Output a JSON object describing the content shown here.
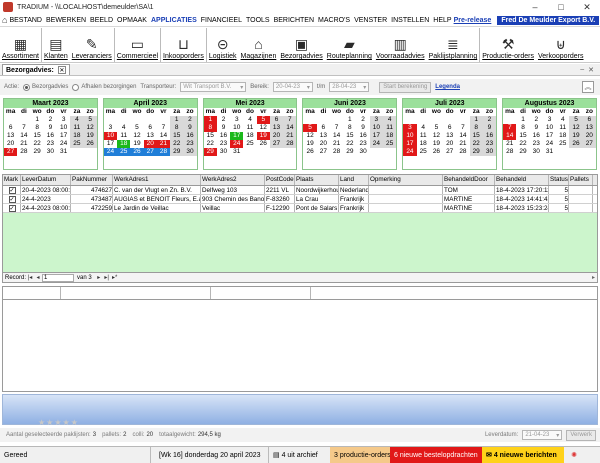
{
  "window": {
    "title": "TRADIUM - \\\\LOCALHOST\\demeulder\\SA\\1",
    "min": "–",
    "max": "□",
    "close": "✕"
  },
  "menu": {
    "items": [
      "BESTAND",
      "BEWERKEN",
      "BEELD",
      "OPMAAK",
      "APPLICATIES",
      "FINANCIEEL",
      "TOOLS",
      "BERICHTEN",
      "MACRO'S",
      "VENSTER",
      "INSTELLEN",
      "HELP"
    ],
    "active": "APPLICATIES",
    "prerelease": "Pre-release",
    "company": "Fred De Meulder Export B.V."
  },
  "toolbar": {
    "items": [
      {
        "label": "Assortiment",
        "icon": "grid-icon"
      },
      {
        "label": "Klanten",
        "icon": "clipboard-icon"
      },
      {
        "label": "Leveranciers",
        "icon": "clipboard-edit-icon"
      },
      {
        "label": "Commercieel",
        "icon": "monitor-icon"
      },
      {
        "label": "Inkooporders",
        "icon": "cart-icon"
      },
      {
        "label": "Logistiek",
        "icon": "arrow-circle-icon"
      },
      {
        "label": "Magazijnen",
        "icon": "warehouse-icon"
      },
      {
        "label": "Bezorgadvies",
        "icon": "delivery-icon"
      },
      {
        "label": "Routeplanning",
        "icon": "truck-icon"
      },
      {
        "label": "Voorraadadvies",
        "icon": "chart-icon"
      },
      {
        "label": "Paklijstplanning",
        "icon": "list-icon"
      },
      {
        "label": "Productie-orders",
        "icon": "wrench-icon"
      },
      {
        "label": "Verkooporders",
        "icon": "basket-icon"
      }
    ]
  },
  "tabs": [
    {
      "label": "Bezorgadvies:",
      "close": "✕"
    }
  ],
  "filters": {
    "actie_label": "Actie:",
    "opt1": "Bezorgadvies",
    "opt2": "Afhalen bezorgingen",
    "transporteur_label": "Transporteur:",
    "transporteur_value": "Wit Transport B.V.",
    "bereik_label": "Bereik:",
    "from": "20-04-23",
    "tm_label": "t/m",
    "to": "28-04-23",
    "start_button": "Start berekening",
    "legenda": "Legenda"
  },
  "calendars": [
    {
      "month": "Maart 2023",
      "weekdays": [
        "ma",
        "di",
        "wo",
        "do",
        "vr",
        "za",
        "zo"
      ],
      "rows": [
        [
          "",
          "",
          "1",
          "2",
          "3",
          "4",
          "5"
        ],
        [
          "6",
          "7",
          "8",
          "9",
          "10",
          "11",
          "12"
        ],
        [
          "13",
          "14",
          "15",
          "16",
          "17",
          "18",
          "19"
        ],
        [
          "20",
          "21",
          "22",
          "23",
          "24",
          "25",
          "26"
        ],
        [
          "27",
          "28",
          "29",
          "30",
          "31",
          "",
          ""
        ]
      ],
      "colors": [
        [
          "",
          "",
          "",
          "",
          "",
          "",
          ""
        ],
        [
          "",
          "",
          "",
          "",
          "",
          "",
          ""
        ],
        [
          "",
          "",
          "",
          "",
          "",
          "",
          ""
        ],
        [
          "",
          "",
          "",
          "",
          "",
          "",
          ""
        ],
        [
          "red",
          "",
          "",
          "",
          "",
          "",
          ""
        ]
      ]
    },
    {
      "month": "April 2023",
      "weekdays": [
        "ma",
        "di",
        "wo",
        "do",
        "vr",
        "za",
        "zo"
      ],
      "rows": [
        [
          "",
          "",
          "",
          "",
          "",
          "1",
          "2"
        ],
        [
          "3",
          "4",
          "5",
          "6",
          "7",
          "8",
          "9"
        ],
        [
          "10",
          "11",
          "12",
          "13",
          "14",
          "15",
          "16"
        ],
        [
          "17",
          "18",
          "19",
          "20",
          "21",
          "22",
          "23"
        ],
        [
          "24",
          "25",
          "26",
          "27",
          "28",
          "29",
          "30"
        ]
      ],
      "colors": [
        [
          "",
          "",
          "",
          "",
          "",
          "",
          ""
        ],
        [
          "",
          "",
          "",
          "",
          "",
          "",
          ""
        ],
        [
          "red",
          "",
          "",
          "",
          "",
          "",
          ""
        ],
        [
          "",
          "green",
          "",
          "red",
          "red",
          "",
          ""
        ],
        [
          "blue",
          "blue",
          "blue",
          "blue",
          "blue",
          "",
          ""
        ]
      ]
    },
    {
      "month": "Mei 2023",
      "weekdays": [
        "ma",
        "di",
        "wo",
        "do",
        "vr",
        "za",
        "zo"
      ],
      "rows": [
        [
          "1",
          "2",
          "3",
          "4",
          "5",
          "6",
          "7"
        ],
        [
          "8",
          "9",
          "10",
          "11",
          "12",
          "13",
          "14"
        ],
        [
          "15",
          "16",
          "17",
          "18",
          "19",
          "20",
          "21"
        ],
        [
          "22",
          "23",
          "24",
          "25",
          "26",
          "27",
          "28"
        ],
        [
          "29",
          "30",
          "31",
          "",
          "",
          "",
          ""
        ]
      ],
      "colors": [
        [
          "red",
          "",
          "",
          "",
          "red",
          "",
          ""
        ],
        [
          "red",
          "",
          "",
          "",
          "",
          "",
          ""
        ],
        [
          "",
          "",
          "green",
          "",
          "red",
          "",
          ""
        ],
        [
          "",
          "",
          "red",
          "",
          "",
          "",
          ""
        ],
        [
          "red",
          "",
          "",
          "",
          "",
          "",
          ""
        ]
      ]
    },
    {
      "month": "Juni 2023",
      "weekdays": [
        "ma",
        "di",
        "wo",
        "do",
        "vr",
        "za",
        "zo"
      ],
      "rows": [
        [
          "",
          "",
          "",
          "1",
          "2",
          "3",
          "4"
        ],
        [
          "5",
          "6",
          "7",
          "8",
          "9",
          "10",
          "11"
        ],
        [
          "12",
          "13",
          "14",
          "15",
          "16",
          "17",
          "18"
        ],
        [
          "19",
          "20",
          "21",
          "22",
          "23",
          "24",
          "25"
        ],
        [
          "26",
          "27",
          "28",
          "29",
          "30",
          "",
          ""
        ]
      ],
      "colors": [
        [
          "",
          "",
          "",
          "",
          "",
          "",
          ""
        ],
        [
          "red",
          "",
          "",
          "",
          "",
          "",
          ""
        ],
        [
          "",
          "",
          "",
          "",
          "",
          "",
          ""
        ],
        [
          "",
          "",
          "",
          "",
          "",
          "",
          ""
        ],
        [
          "",
          "",
          "",
          "",
          "",
          "",
          ""
        ]
      ]
    },
    {
      "month": "Juli 2023",
      "weekdays": [
        "ma",
        "di",
        "wo",
        "do",
        "vr",
        "za",
        "zo"
      ],
      "rows": [
        [
          "",
          "",
          "",
          "",
          "",
          "1",
          "2"
        ],
        [
          "3",
          "4",
          "5",
          "6",
          "7",
          "8",
          "9"
        ],
        [
          "10",
          "11",
          "12",
          "13",
          "14",
          "15",
          "16"
        ],
        [
          "17",
          "18",
          "19",
          "20",
          "21",
          "22",
          "23"
        ],
        [
          "24",
          "25",
          "26",
          "27",
          "28",
          "29",
          "30"
        ]
      ],
      "colors": [
        [
          "",
          "",
          "",
          "",
          "",
          "",
          ""
        ],
        [
          "red",
          "",
          "",
          "",
          "",
          "",
          ""
        ],
        [
          "red",
          "",
          "",
          "",
          "",
          "",
          ""
        ],
        [
          "red",
          "",
          "",
          "",
          "",
          "",
          ""
        ],
        [
          "red",
          "",
          "",
          "",
          "",
          "",
          ""
        ]
      ]
    },
    {
      "month": "Augustus 2023",
      "weekdays": [
        "ma",
        "di",
        "wo",
        "do",
        "vr",
        "za",
        "zo"
      ],
      "rows": [
        [
          "",
          "1",
          "2",
          "3",
          "4",
          "5",
          "6"
        ],
        [
          "7",
          "8",
          "9",
          "10",
          "11",
          "12",
          "13"
        ],
        [
          "14",
          "15",
          "16",
          "17",
          "18",
          "19",
          "20"
        ],
        [
          "21",
          "22",
          "23",
          "24",
          "25",
          "26",
          "27"
        ],
        [
          "28",
          "29",
          "30",
          "31",
          "",
          "",
          ""
        ]
      ],
      "colors": [
        [
          "",
          "",
          "",
          "",
          "",
          "",
          ""
        ],
        [
          "red",
          "",
          "",
          "",
          "",
          "",
          ""
        ],
        [
          "red",
          "",
          "",
          "",
          "",
          "",
          ""
        ],
        [
          "",
          "",
          "",
          "",
          "",
          "",
          ""
        ],
        [
          "",
          "",
          "",
          "",
          "",
          "",
          ""
        ]
      ]
    }
  ],
  "grid": {
    "columns": [
      "Mark",
      "LeverDatum",
      "PakNummer",
      "WerkAdres1",
      "WerkAdres2",
      "PostCode",
      "Plaats",
      "Land",
      "Opmerking",
      "BehandeldDoor",
      "Behandeld",
      "Status",
      "Pallets"
    ],
    "rows": [
      [
        "✓",
        "20-4-2023 08:00:00",
        "474627",
        "C. van der Vlugt en Zn. B.V.",
        "Delfweg 103",
        "2211 VL",
        "Noordwijkerhout",
        "Nederland",
        "",
        "TOM",
        "18-4-2023 17:20:11",
        "5",
        ""
      ],
      [
        "✓",
        "24-4-2023",
        "473487",
        "AUGIAS et BENOIT Fleurs, E.a.r.l.",
        "903 Chemin des Banons",
        "F-83260",
        "La Crau",
        "Frankrijk",
        "",
        "MARTINE",
        "18-4-2023 14:41:42",
        "5",
        ""
      ],
      [
        "✓",
        "24-4-2023 08:00:00",
        "472259",
        "Le Jardin de Veillac",
        "Veillac",
        "F-12290",
        "Pont de Salars",
        "Frankrijk",
        "",
        "MARTINE",
        "18-4-2023 15:23:24",
        "5",
        ""
      ]
    ]
  },
  "recnav": {
    "label": "Record:",
    "current": "1",
    "of": "van 3"
  },
  "summary": {
    "pak_label": "Aantal geselecteerde paklijsten:",
    "pak_value": "3",
    "pallets_label": "pallets:",
    "pallets_value": "2",
    "colli_label": "colli:",
    "colli_value": "20",
    "gewicht_label": "totaalgewicht:",
    "gewicht_value": "294,5 kg",
    "leverdatum_label": "Leverdatum:",
    "leverdatum_value": "21-04-23",
    "verwerk": "Verwerk"
  },
  "status": {
    "ready": "Gereed",
    "week": "[Wk 16] donderdag 20 april 2023",
    "archief": "4 uit archief",
    "productie": "3 productie-orders",
    "nieuwe": "6 nieuwe bestelopdrachten",
    "berichten": "4 nieuwe berichten"
  }
}
